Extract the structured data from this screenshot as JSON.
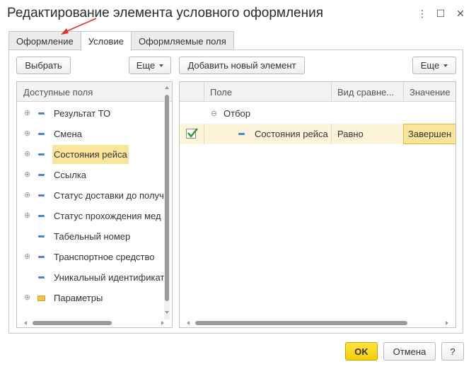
{
  "window": {
    "title": "Редактирование элемента условного оформления",
    "more_glyph": "⋮",
    "maximize_glyph": "☐",
    "close_glyph": "✕"
  },
  "tabs": [
    {
      "label": "Оформление",
      "active": false
    },
    {
      "label": "Условие",
      "active": true
    },
    {
      "label": "Оформляемые поля",
      "active": false
    }
  ],
  "left": {
    "select_button": "Выбрать",
    "more_button": "Еще",
    "header": "Доступные поля",
    "items": [
      {
        "label": "Результат ТО",
        "expandable": true,
        "kind": "field",
        "selected": false
      },
      {
        "label": "Смена",
        "expandable": true,
        "kind": "field",
        "selected": false
      },
      {
        "label": "Состояния рейса",
        "expandable": true,
        "kind": "field",
        "selected": true
      },
      {
        "label": "Ссылка",
        "expandable": true,
        "kind": "field",
        "selected": false
      },
      {
        "label": "Статус доставки до получ",
        "expandable": true,
        "kind": "field",
        "selected": false
      },
      {
        "label": "Статус прохождения мед",
        "expandable": true,
        "kind": "field",
        "selected": false
      },
      {
        "label": "Табельный номер",
        "expandable": false,
        "kind": "field",
        "selected": false
      },
      {
        "label": "Транспортное средство",
        "expandable": true,
        "kind": "field",
        "selected": false
      },
      {
        "label": "Уникальный идентификато",
        "expandable": false,
        "kind": "field",
        "selected": false
      },
      {
        "label": "Параметры",
        "expandable": true,
        "kind": "folder",
        "selected": false
      }
    ]
  },
  "right": {
    "add_button": "Добавить новый элемент",
    "more_button": "Еще",
    "columns": [
      "Поле",
      "Вид сравне...",
      "Значение"
    ],
    "group_label": "Отбор",
    "rows": [
      {
        "checked": true,
        "field": "Состояния рейса",
        "comparison": "Равно",
        "value": "Завершен"
      }
    ]
  },
  "footer": {
    "ok": "OK",
    "cancel": "Отмена",
    "help": "?"
  },
  "colors": {
    "accent_yellow": "#f5cf00",
    "selection": "#fbe59b",
    "row_highlight": "#fdf5d9",
    "annotation_arrow": "#e03030"
  }
}
